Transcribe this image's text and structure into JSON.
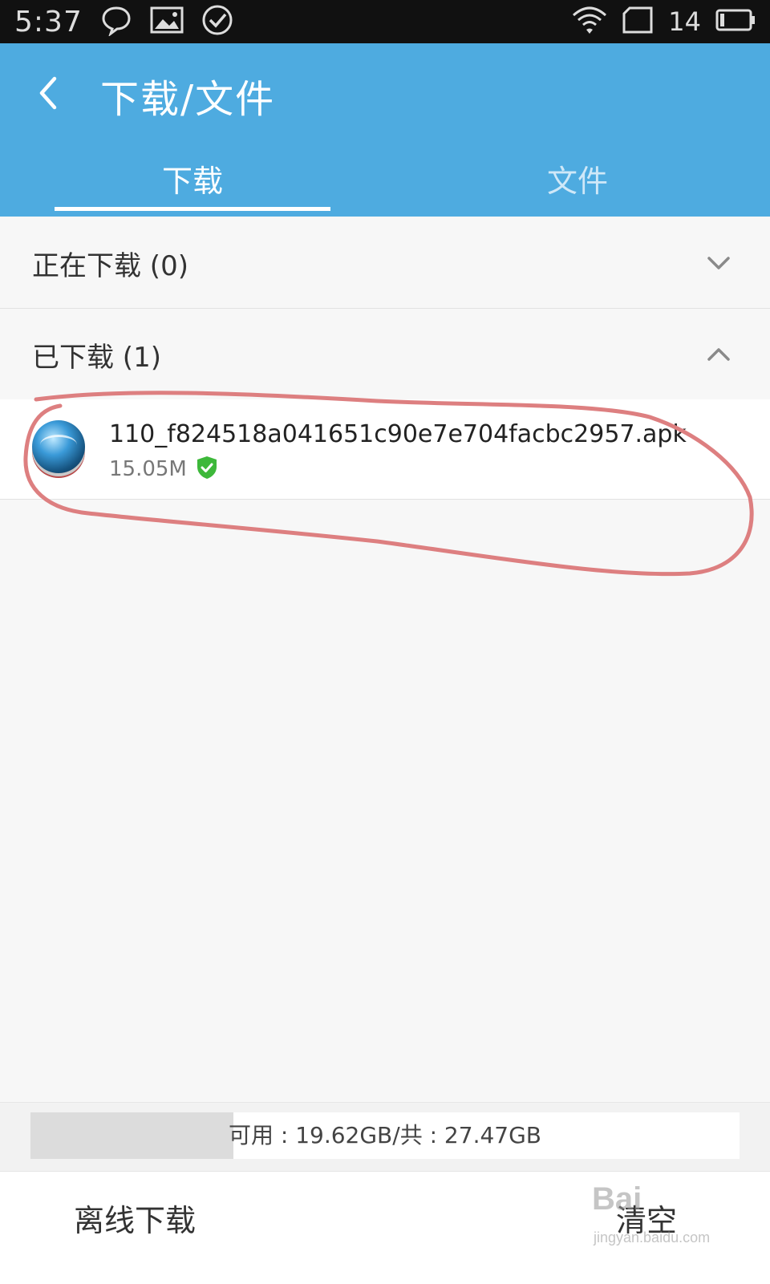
{
  "status_bar": {
    "time": "5:37",
    "icons_left": [
      "chat-bubble-icon",
      "image-icon",
      "check-circle-icon"
    ],
    "icons_right": [
      "wifi-icon",
      "sim-card-icon",
      "battery-icon"
    ],
    "notification_count": "14"
  },
  "header": {
    "title": "下载/文件",
    "back_icon": "chevron-left-icon",
    "color": "#4eabe0"
  },
  "tabs": [
    {
      "label": "下载",
      "active": true
    },
    {
      "label": "文件",
      "active": false
    }
  ],
  "sections": {
    "downloading": {
      "label": "正在下载 (0)",
      "icon": "chevron-down-icon"
    },
    "downloaded": {
      "label": "已下载 (1)",
      "icon": "chevron-up-icon"
    }
  },
  "files": [
    {
      "name": "110_f824518a041651c90e7e704facbc2957.apk",
      "size": "15.05M",
      "icon": "app-globe-icon",
      "status_icon": "verified-shield-icon"
    }
  ],
  "storage": {
    "text": "可用 : 19.62GB/共 : 27.47GB",
    "used_fraction": 0.286
  },
  "bottom_actions": {
    "offline_label": "离线下载",
    "clear_label": "清空"
  },
  "watermark": {
    "text": "Bai",
    "sub": "jingyan.baidu.com"
  }
}
